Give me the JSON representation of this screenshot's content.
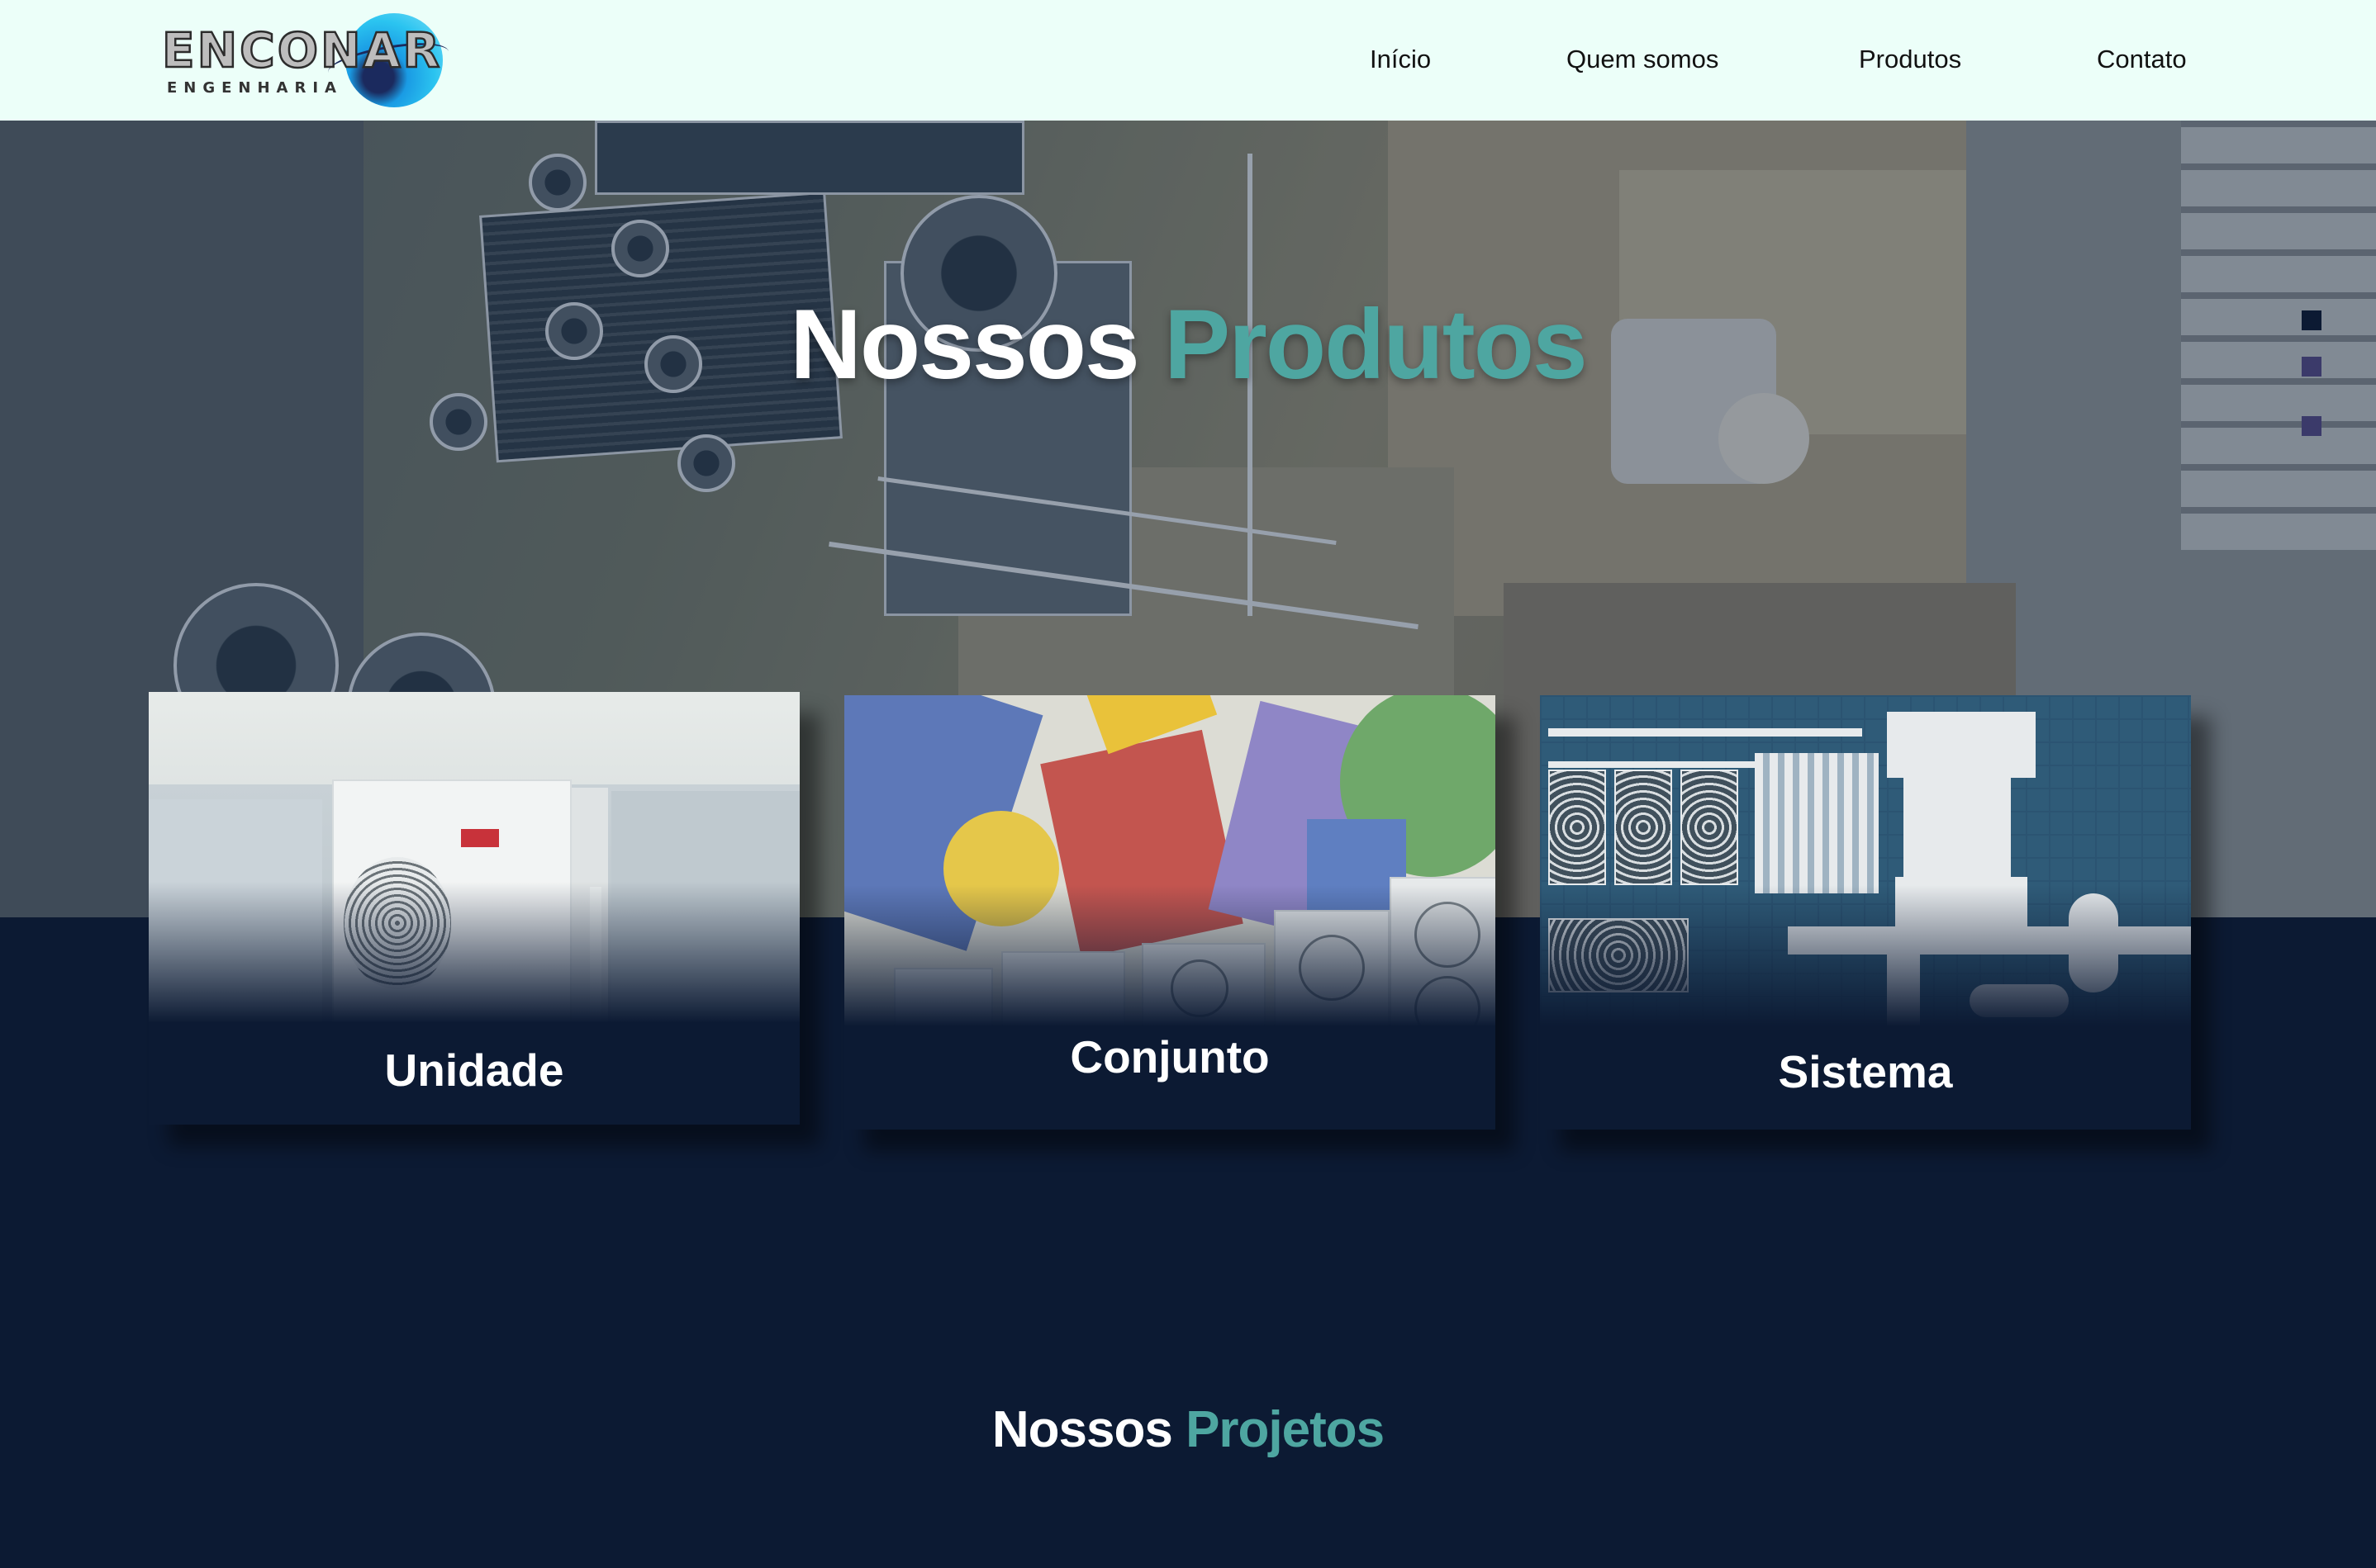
{
  "header": {
    "logo": {
      "wordmark": "ENCONAR",
      "subtitle": "ENGENHARIA"
    },
    "nav": [
      {
        "label": "Início"
      },
      {
        "label": "Quem somos"
      },
      {
        "label": "Produtos"
      },
      {
        "label": "Contato"
      }
    ]
  },
  "hero": {
    "title_part1": "Nossos",
    "title_part2": "Produtos"
  },
  "slider_dots": [
    {
      "color": "#0c1a33",
      "active": true
    },
    {
      "color": "#3b3a6a",
      "active": false
    },
    {
      "color": "#3b3a6a",
      "active": false
    }
  ],
  "products": [
    {
      "label": "Unidade"
    },
    {
      "label": "Conjunto"
    },
    {
      "label": "Sistema"
    }
  ],
  "projects": {
    "title_part1": "Nossos",
    "title_part2": "Projetos"
  },
  "colors": {
    "header_bg": "#ecfff9",
    "page_bg": "#0c1a33",
    "accent": "#4ea6a1",
    "text_light": "#ffffff"
  }
}
